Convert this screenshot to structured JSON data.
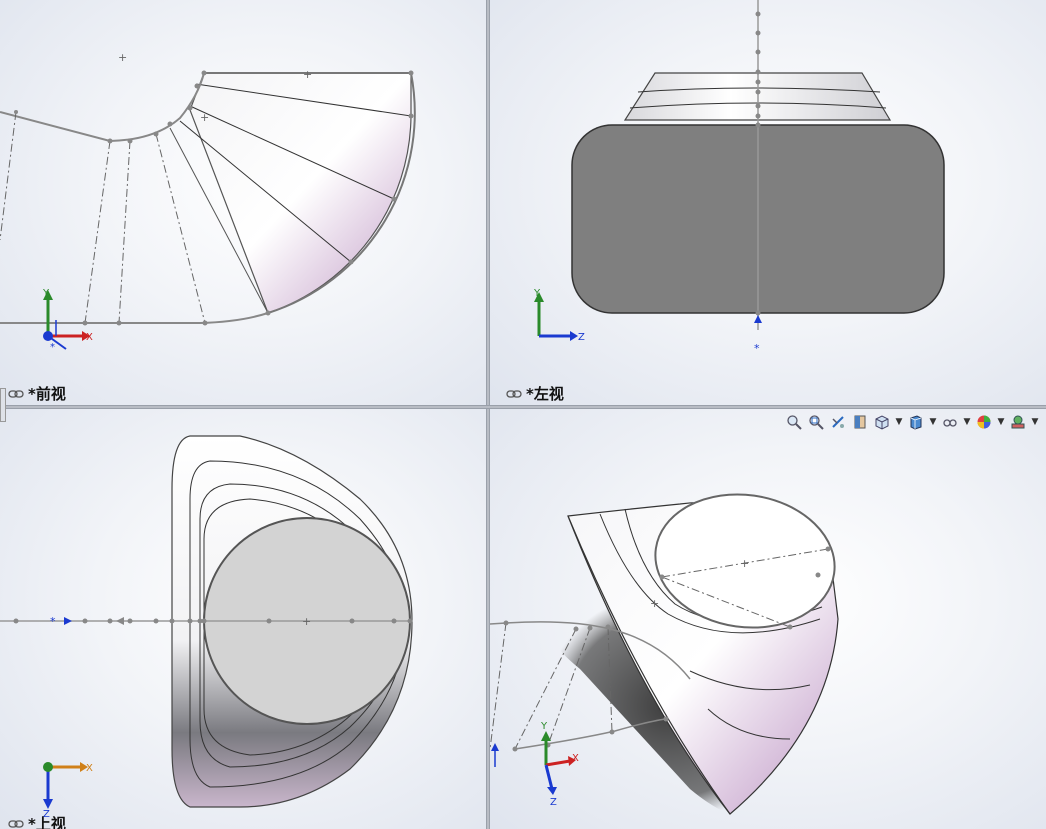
{
  "views": {
    "front": {
      "label": "*前视"
    },
    "left": {
      "label": "*左视"
    },
    "top": {
      "label": "*上视"
    }
  },
  "axes": {
    "x": "X",
    "y": "Y",
    "z": "Z"
  },
  "toolbar": {
    "icons": [
      "zoom-to-fit-icon",
      "zoom-to-area-icon",
      "previous-view-icon",
      "section-view-icon",
      "view-orientation-icon",
      "display-style-icon",
      "hide-show-items-icon",
      "edit-appearance-icon",
      "apply-scene-icon"
    ]
  },
  "colors": {
    "shaded_gray": "#7f7f7f",
    "x_axis": "#cc2222",
    "y_axis": "#2a8a2a",
    "z_axis": "#1a3ad0"
  }
}
